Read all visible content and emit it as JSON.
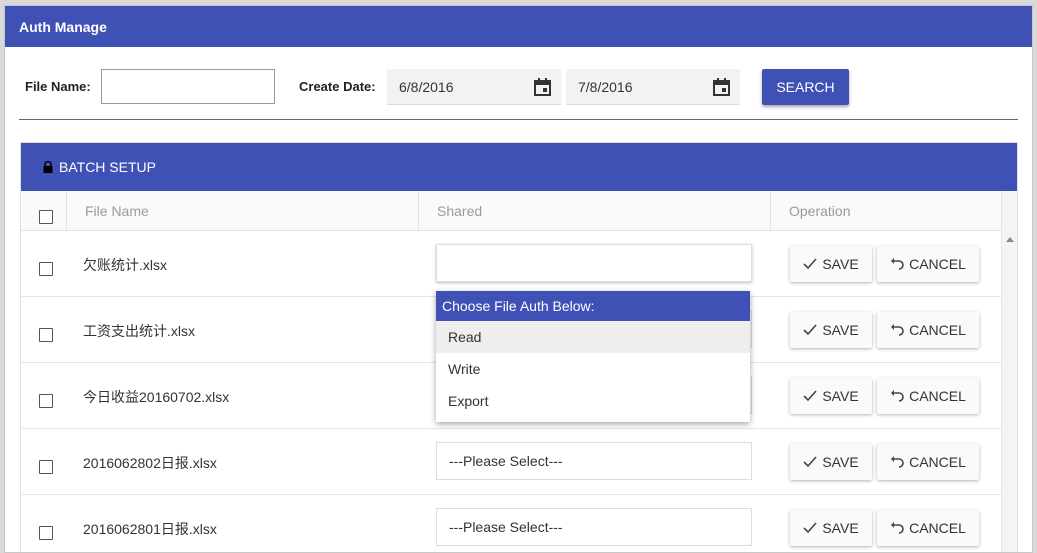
{
  "header": {
    "title": "Auth Manage"
  },
  "search": {
    "file_name_label": "File Name:",
    "file_name_value": "",
    "create_date_label": "Create Date:",
    "date_from": "6/8/2016",
    "date_to": "7/8/2016",
    "search_label": "SEARCH"
  },
  "grid": {
    "toolbar_label": "BATCH SETUP",
    "columns": {
      "file_name": "File Name",
      "shared": "Shared",
      "operation": "Operation"
    },
    "rows": [
      {
        "file_name": "欠账统计.xlsx",
        "shared": ""
      },
      {
        "file_name": "工资支出统计.xlsx",
        "shared": ""
      },
      {
        "file_name": "今日收益20160702.xlsx",
        "shared": ""
      },
      {
        "file_name": "2016062802日报.xlsx",
        "shared": "---Please Select---"
      },
      {
        "file_name": "2016062801日报.xlsx",
        "shared": "---Please Select---"
      }
    ],
    "save_label": "SAVE",
    "cancel_label": "CANCEL"
  },
  "dropdown": {
    "header": "Choose File Auth Below:",
    "options": [
      "Read",
      "Write",
      "Export"
    ],
    "highlighted": "Read"
  },
  "colors": {
    "primary": "#3f51b5",
    "header_text": "#ffffff"
  },
  "icons": {
    "date": "calendar-icon",
    "lock": "lock-icon",
    "save": "check-icon",
    "cancel": "undo-icon"
  }
}
